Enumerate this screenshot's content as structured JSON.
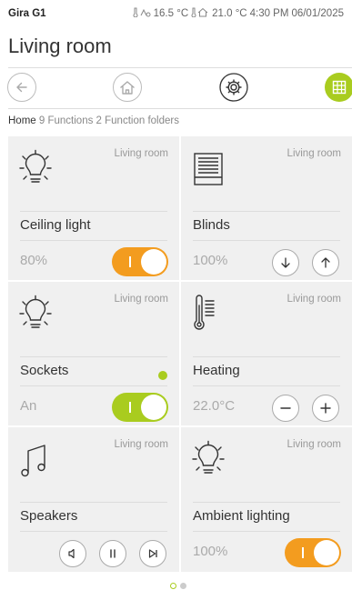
{
  "statusbar": {
    "device": "Gira G1",
    "outdoor_temp": "16.5 °C",
    "indoor_temp": "21.0 °C",
    "time": "4:30 PM",
    "date": "06/01/2025"
  },
  "page": {
    "title": "Living room"
  },
  "navbar": {
    "icons": [
      "arrow-left-icon",
      "home-icon",
      "gear-icon",
      "grid-icon"
    ],
    "accent": "#a9cc1f"
  },
  "breadcrumb": {
    "home": "Home",
    "functions": "9 Functions",
    "folders": "2 Function folders"
  },
  "tiles": [
    {
      "room": "Living room",
      "name": "Ceiling light",
      "value": "80%",
      "icon": "lightbulb-icon",
      "control": "toggle",
      "on": true,
      "toggle_color": "#f39c1f"
    },
    {
      "room": "Living room",
      "name": "Blinds",
      "value": "100%",
      "icon": "blinds-icon",
      "control": "up-down"
    },
    {
      "room": "Living room",
      "name": "Sockets",
      "value": "An",
      "icon": "lightbulb-icon",
      "control": "toggle",
      "on": true,
      "toggle_color": "#a9cc1f",
      "status_dot": "#a9cc1f"
    },
    {
      "room": "Living room",
      "name": "Heating",
      "value": "22.0°C",
      "icon": "thermometer-icon",
      "control": "minus-plus"
    },
    {
      "room": "Living room",
      "name": "Speakers",
      "value": "",
      "icon": "music-note-icon",
      "control": "media"
    },
    {
      "room": "Living room",
      "name": "Ambient lighting",
      "value": "100%",
      "icon": "lightbulb-icon",
      "control": "toggle",
      "on": true,
      "toggle_color": "#f39c1f"
    }
  ],
  "pager": {
    "pages": 2,
    "current": 1
  },
  "colors": {
    "orange": "#f39c1f",
    "green": "#a9cc1f"
  }
}
